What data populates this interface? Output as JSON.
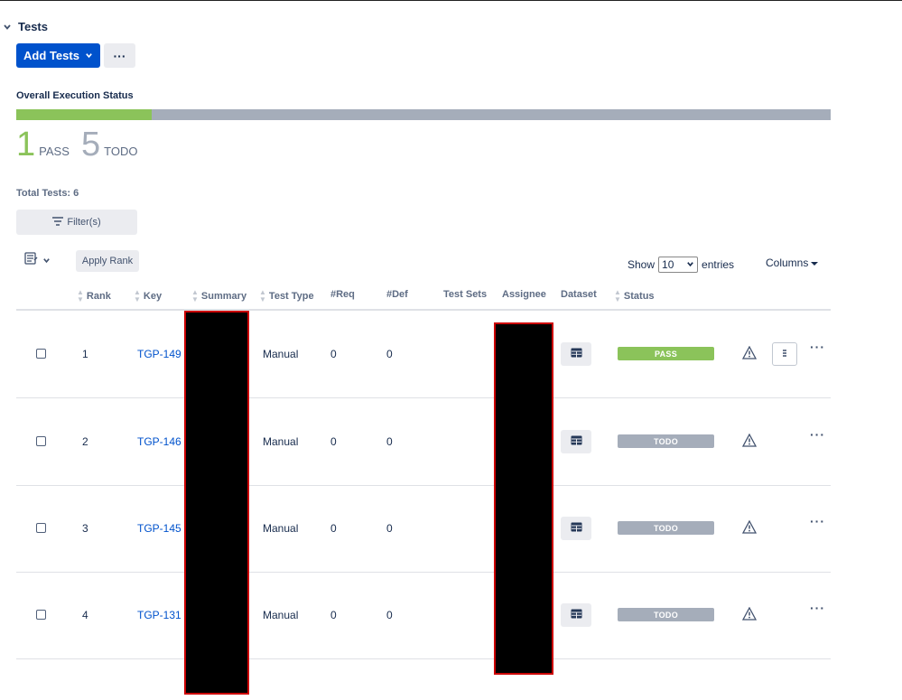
{
  "section": {
    "title": "Tests"
  },
  "toolbar": {
    "add_tests_label": "Add Tests",
    "more_label": "···"
  },
  "execution": {
    "label": "Overall Execution Status",
    "pass_fraction": 0.1667,
    "pass_count": "1",
    "pass_label": "PASS",
    "todo_count": "5",
    "todo_label": "TODO",
    "colors": {
      "pass": "#8bc35a",
      "todo": "#a5adba"
    }
  },
  "total_tests": "Total Tests: 6",
  "filter": {
    "label": "Filter(s)"
  },
  "apply_rank": {
    "label": "Apply Rank"
  },
  "paging": {
    "show_label": "Show",
    "entries_value": "10",
    "entries_label": "entries"
  },
  "columns_label": "Columns",
  "table": {
    "headers": {
      "rank": "Rank",
      "key": "Key",
      "summary": "Summary",
      "test_type": "Test Type",
      "req": "#Req",
      "def": "#Def",
      "test_sets": "Test Sets",
      "assignee": "Assignee",
      "dataset": "Dataset",
      "status": "Status"
    },
    "rows": [
      {
        "rank": "1",
        "key": "TGP-149",
        "test_type": "Manual",
        "req": "0",
        "def": "0",
        "status": "PASS"
      },
      {
        "rank": "2",
        "key": "TGP-146",
        "test_type": "Manual",
        "req": "0",
        "def": "0",
        "status": "TODO"
      },
      {
        "rank": "3",
        "key": "TGP-145",
        "test_type": "Manual",
        "req": "0",
        "def": "0",
        "status": "TODO"
      },
      {
        "rank": "4",
        "key": "TGP-131",
        "test_type": "Manual",
        "req": "0",
        "def": "0",
        "status": "TODO"
      }
    ]
  },
  "status_colors": {
    "PASS": "#8bc35a",
    "TODO": "#a5adba"
  },
  "accent": "#0052cc"
}
